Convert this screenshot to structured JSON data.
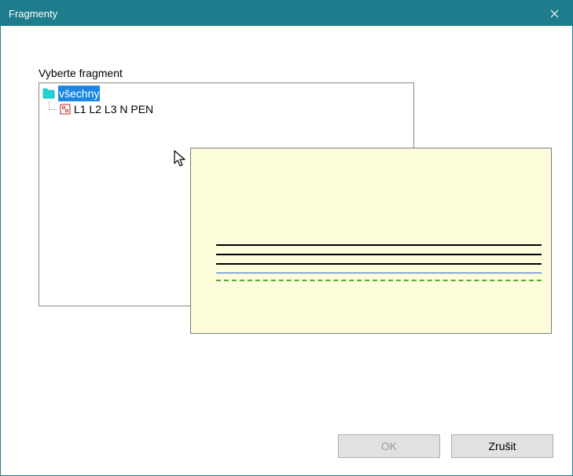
{
  "window": {
    "title": "Fragmenty",
    "close_label": "Close"
  },
  "body": {
    "field_label": "Vyberte fragment",
    "root_node": "všechny",
    "child_node": "L1 L2 L3 N PEN"
  },
  "buttons": {
    "ok": "OK",
    "cancel": "Zrušit"
  }
}
